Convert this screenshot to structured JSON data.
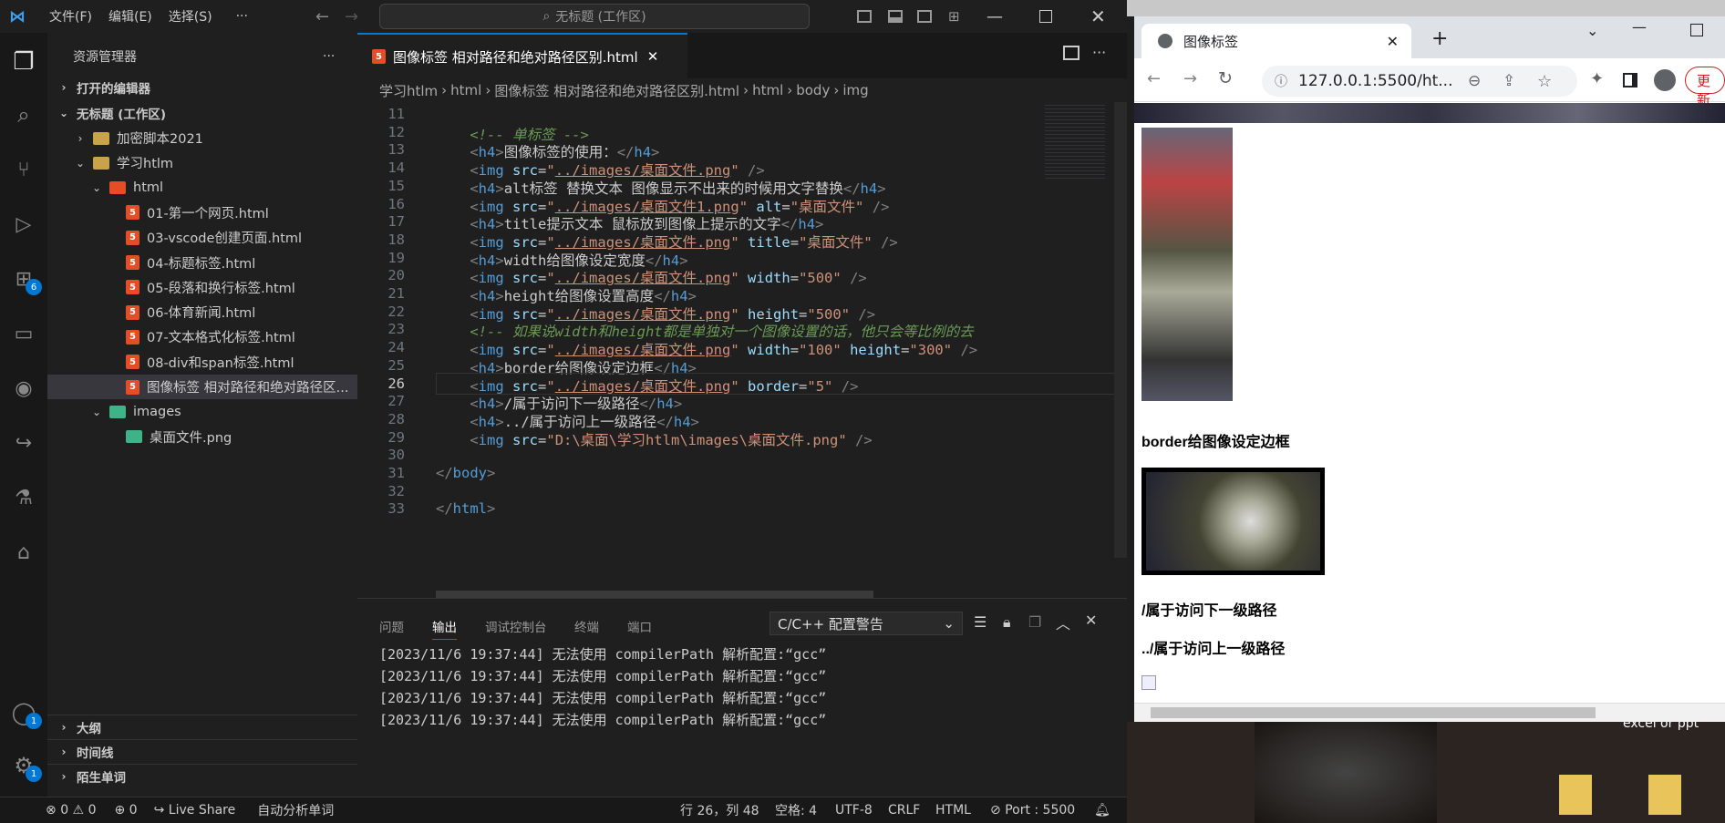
{
  "titlebar": {
    "menus": [
      "文件(F)",
      "编辑(E)",
      "选择(S)",
      "···"
    ],
    "search": "无标题 (工作区)"
  },
  "activity": {
    "extensions_badge": "6",
    "accounts_badge": "1",
    "settings_badge": "1"
  },
  "sidebar": {
    "title": "资源管理器",
    "more": "···",
    "open_editors": "打开的编辑器",
    "workspace": "无标题 (工作区)",
    "items": [
      {
        "label": "加密脚本2021",
        "kind": "folder",
        "indent": 1,
        "open": false
      },
      {
        "label": "学习htlm",
        "kind": "folder",
        "indent": 1,
        "open": true
      },
      {
        "label": "html",
        "kind": "folder",
        "indent": 2,
        "open": true
      },
      {
        "label": "01-第一个网页.html",
        "kind": "html",
        "indent": 3
      },
      {
        "label": "03-vscode创建页面.html",
        "kind": "html",
        "indent": 3
      },
      {
        "label": "04-标题标签.html",
        "kind": "html",
        "indent": 3
      },
      {
        "label": "05-段落和换行标签.html",
        "kind": "html",
        "indent": 3
      },
      {
        "label": "06-体育新闻.html",
        "kind": "html",
        "indent": 3
      },
      {
        "label": "07-文本格式化标签.html",
        "kind": "html",
        "indent": 3
      },
      {
        "label": "08-div和span标签.html",
        "kind": "html",
        "indent": 3
      },
      {
        "label": "图像标签 相对路径和绝对路径区...",
        "kind": "html",
        "indent": 3,
        "selected": true
      },
      {
        "label": "images",
        "kind": "folder",
        "indent": 2,
        "open": true
      },
      {
        "label": "桌面文件.png",
        "kind": "image",
        "indent": 3
      }
    ],
    "outline": "大纲",
    "timeline": "时间线",
    "words": "陌生单词"
  },
  "editor": {
    "tab": "图像标签 相对路径和绝对路径区别.html",
    "breadcrumbs": [
      "学习htlm",
      "html",
      "图像标签 相对路径和绝对路径区别.html",
      "html",
      "body",
      "img"
    ],
    "lines": [
      {
        "n": "11",
        "html": ""
      },
      {
        "n": "12",
        "html": "    <span class='c'>&lt;!-- 单标签 --&gt;</span>"
      },
      {
        "n": "13",
        "html": "    <span class='p'>&lt;</span><span class='t'>h4</span><span class='p'>&gt;</span>图像标签的使用：<span class='p'>&lt;/</span><span class='t'>h4</span><span class='p'>&gt;</span>"
      },
      {
        "n": "14",
        "html": "    <span class='p'>&lt;</span><span class='t'>img</span> <span class='a'>src</span>=<span class='s'>\"<span class='u'>../images/桌面文件.png</span>\"</span> <span class='p'>/&gt;</span>"
      },
      {
        "n": "15",
        "html": "    <span class='p'>&lt;</span><span class='t'>h4</span><span class='p'>&gt;</span>alt标签 替换文本 图像显示不出来的时候用文字替换<span class='p'>&lt;/</span><span class='t'>h4</span><span class='p'>&gt;</span>"
      },
      {
        "n": "16",
        "html": "    <span class='p'>&lt;</span><span class='t'>img</span> <span class='a'>src</span>=<span class='s'>\"<span class='u'>../images/桌面文件1.png</span>\"</span> <span class='a'>alt</span>=<span class='s'>\"桌面文件\"</span> <span class='p'>/&gt;</span>"
      },
      {
        "n": "17",
        "html": "    <span class='p'>&lt;</span><span class='t'>h4</span><span class='p'>&gt;</span>title提示文本 鼠标放到图像上提示的文字<span class='p'>&lt;/</span><span class='t'>h4</span><span class='p'>&gt;</span>"
      },
      {
        "n": "18",
        "html": "    <span class='p'>&lt;</span><span class='t'>img</span> <span class='a'>src</span>=<span class='s'>\"<span class='u'>../images/桌面文件.png</span>\"</span> <span class='a'>title</span>=<span class='s'>\"桌面文件\"</span> <span class='p'>/&gt;</span>"
      },
      {
        "n": "19",
        "html": "    <span class='p'>&lt;</span><span class='t'>h4</span><span class='p'>&gt;</span>width给图像设定宽度<span class='p'>&lt;/</span><span class='t'>h4</span><span class='p'>&gt;</span>"
      },
      {
        "n": "20",
        "html": "    <span class='p'>&lt;</span><span class='t'>img</span> <span class='a'>src</span>=<span class='s'>\"<span class='u'>../images/桌面文件.png</span>\"</span> <span class='a'>width</span>=<span class='s'>\"500\"</span> <span class='p'>/&gt;</span>"
      },
      {
        "n": "21",
        "html": "    <span class='p'>&lt;</span><span class='t'>h4</span><span class='p'>&gt;</span>height给图像设置高度<span class='p'>&lt;/</span><span class='t'>h4</span><span class='p'>&gt;</span>"
      },
      {
        "n": "22",
        "html": "    <span class='p'>&lt;</span><span class='t'>img</span> <span class='a'>src</span>=<span class='s'>\"<span class='u'>../images/桌面文件.png</span>\"</span> <span class='a'>height</span>=<span class='s'>\"500\"</span> <span class='p'>/&gt;</span>"
      },
      {
        "n": "23",
        "html": "    <span class='c'>&lt;!-- 如果说width和height都是单独对一个图像设置的话，他只会等比例的去</span>"
      },
      {
        "n": "24",
        "html": "    <span class='p'>&lt;</span><span class='t'>img</span> <span class='a'>src</span>=<span class='s'>\"<span class='u'>../images/桌面文件.png</span>\"</span> <span class='a'>width</span>=<span class='s'>\"100\"</span> <span class='a'>height</span>=<span class='s'>\"300\"</span> <span class='p'>/&gt;</span>"
      },
      {
        "n": "25",
        "html": "    <span class='p'>&lt;</span><span class='t'>h4</span><span class='p'>&gt;</span>border给图像设定边框<span class='p'>&lt;/</span><span class='t'>h4</span><span class='p'>&gt;</span>"
      },
      {
        "n": "26",
        "html": "    <span class='p'>&lt;</span><span class='t'>img</span> <span class='a'>src</span>=<span class='s'>\"<span class='u'>../images/桌面文件.png</span>\"</span> <span class='a'>border</span>=<span class='s'>\"5\"</span> <span class='p'>/&gt;</span>",
        "current": true
      },
      {
        "n": "27",
        "html": "    <span class='p'>&lt;</span><span class='t'>h4</span><span class='p'>&gt;</span>/属于访问下一级路径<span class='p'>&lt;/</span><span class='t'>h4</span><span class='p'>&gt;</span>"
      },
      {
        "n": "28",
        "html": "    <span class='p'>&lt;</span><span class='t'>h4</span><span class='p'>&gt;</span>../属于访问上一级路径<span class='p'>&lt;/</span><span class='t'>h4</span><span class='p'>&gt;</span>"
      },
      {
        "n": "29",
        "html": "    <span class='p'>&lt;</span><span class='t'>img</span> <span class='a'>src</span>=<span class='s'>\"D:\\桌面\\学习htlm\\images\\桌面文件.png\"</span> <span class='p'>/&gt;</span>"
      },
      {
        "n": "30",
        "html": ""
      },
      {
        "n": "31",
        "html": "<span class='p'>&lt;/</span><span class='t'>body</span><span class='p'>&gt;</span>"
      },
      {
        "n": "32",
        "html": ""
      },
      {
        "n": "33",
        "html": "<span class='p'>&lt;/</span><span class='t'>html</span><span class='p'>&gt;</span>"
      }
    ]
  },
  "panel": {
    "tabs": [
      "问题",
      "输出",
      "调试控制台",
      "终端",
      "端口"
    ],
    "active_tab": "输出",
    "channel": "C/C++ 配置警告",
    "lines": [
      "[2023/11/6 19:37:44] 无法使用 compilerPath 解析配置:“gcc”",
      "[2023/11/6 19:37:44] 无法使用 compilerPath 解析配置:“gcc”",
      "[2023/11/6 19:37:44] 无法使用 compilerPath 解析配置:“gcc”",
      "[2023/11/6 19:37:44] 无法使用 compilerPath 解析配置:“gcc”"
    ]
  },
  "status": {
    "errors": "0",
    "warnings": "0",
    "ports": "0",
    "live_share": "Live Share",
    "auto": "自动分析单词",
    "position": "行 26，列 48",
    "spaces": "空格: 4",
    "encoding": "UTF-8",
    "eol": "CRLF",
    "lang": "HTML",
    "port": "Port : 5500"
  },
  "browser": {
    "tab": "图像标签",
    "url": "127.0.0.1:5500/ht...",
    "update": "更新",
    "headings": [
      "border给图像设定边框",
      "/属于访问下一级路径",
      "../属于访问上一级路径"
    ],
    "desktop_label": "excel or ppt"
  }
}
